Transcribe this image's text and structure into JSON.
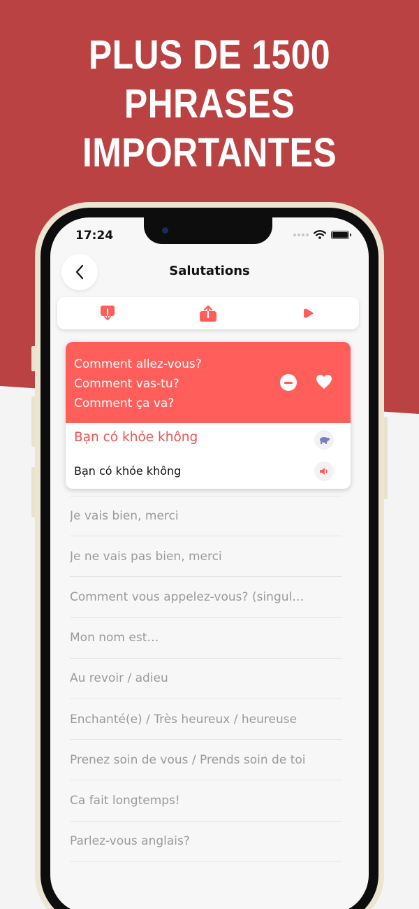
{
  "headline": {
    "lines": [
      "PLUS DE 1500",
      "PHRASES",
      "IMPORTANTES"
    ]
  },
  "colors": {
    "background_red": "#bb4242",
    "accent": "#ff5e5b",
    "transliteration": "#ef5350"
  },
  "status_bar": {
    "time": "17:24",
    "icons": [
      "cellular-icon",
      "wifi-icon",
      "battery-icon"
    ]
  },
  "header": {
    "title": "Salutations",
    "back_icon": "chevron-left-icon"
  },
  "toolbar": {
    "icons": [
      "download-icon",
      "share-icon",
      "play-icon"
    ]
  },
  "selected_phrase": {
    "french_lines": [
      "Comment allez-vous?",
      "Comment vas-tu?",
      "Comment ça va?"
    ],
    "transliteration": "Bạn có khỏe không",
    "translation": "Bạn có khỏe không",
    "icons": [
      "remove-icon",
      "heart-icon",
      "slow-playback-icon",
      "speaker-icon"
    ]
  },
  "phrases": [
    "Je vais bien, merci",
    "Je ne vais pas bien, merci",
    "Comment vous appelez-vous? (singul…",
    "Mon nom est…",
    "Au revoir / adieu",
    "Enchanté(e) / Très heureux / heureuse",
    "Prenez soin de vous / Prends soin de toi",
    "Ca fait longtemps!",
    "Parlez-vous anglais?"
  ]
}
